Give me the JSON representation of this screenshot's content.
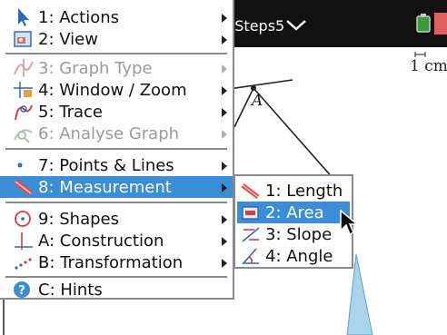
{
  "document": {
    "title": "tSteps5",
    "scale_label": "1 cm",
    "point_label": "A"
  },
  "menu": {
    "items": [
      {
        "label": "1: Actions",
        "icon": "pointer-arrow-icon",
        "state": "enabled"
      },
      {
        "label": "2: View",
        "icon": "view-icon",
        "state": "enabled"
      },
      {
        "label": "3: Graph Type",
        "icon": "graph-type-icon",
        "state": "disabled"
      },
      {
        "label": "4: Window / Zoom",
        "icon": "window-zoom-icon",
        "state": "enabled"
      },
      {
        "label": "5: Trace",
        "icon": "trace-icon",
        "state": "enabled"
      },
      {
        "label": "6: Analyse Graph",
        "icon": "analyse-graph-icon",
        "state": "disabled"
      },
      {
        "label": "7: Points & Lines",
        "icon": "points-lines-icon",
        "state": "enabled"
      },
      {
        "label": "8: Measurement",
        "icon": "measurement-icon",
        "state": "selected"
      },
      {
        "label": "9: Shapes",
        "icon": "shapes-icon",
        "state": "enabled"
      },
      {
        "label": "A: Construction",
        "icon": "construction-icon",
        "state": "enabled"
      },
      {
        "label": "B: Transformation",
        "icon": "transformation-icon",
        "state": "enabled"
      },
      {
        "label": "C: Hints",
        "icon": "hints-icon",
        "state": "enabled"
      }
    ]
  },
  "submenu": {
    "items": [
      {
        "label": "1: Length",
        "icon": "length-icon",
        "state": "enabled"
      },
      {
        "label": "2: Area",
        "icon": "area-icon",
        "state": "selected"
      },
      {
        "label": "3: Slope",
        "icon": "slope-icon",
        "state": "enabled"
      },
      {
        "label": "4: Angle",
        "icon": "angle-icon",
        "state": "enabled"
      }
    ]
  },
  "colors": {
    "selection": "#3a8ed8",
    "title_bar": "#111111",
    "callout": "#a8d4ec"
  }
}
